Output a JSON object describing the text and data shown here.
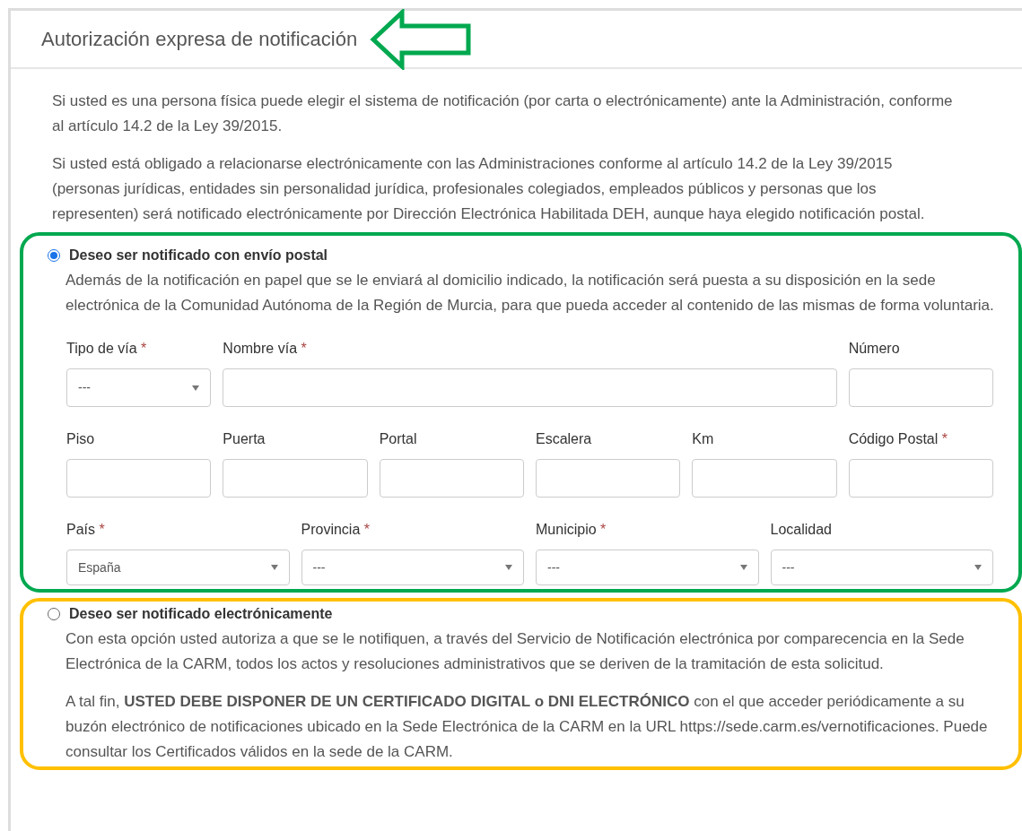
{
  "panel": {
    "title": "Autorización expresa de notificación"
  },
  "intro": [
    "Si usted es una persona física puede elegir el sistema de notificación (por carta o electrónicamente) ante la Administración, conforme al artículo 14.2 de la Ley 39/2015.",
    "Si usted está obligado a relacionarse electrónicamente con las Administraciones conforme al artículo 14.2 de la Ley 39/2015 (personas jurídicas, entidades sin personalidad jurídica, profesionales colegiados, empleados públicos y personas que los representen) será notificado electrónicamente por Dirección Electrónica Habilitada DEH, aunque haya elegido notificación postal."
  ],
  "options": [
    {
      "label": "Deseo ser notificado con envío postal",
      "selected": true,
      "paragraphs": [
        "Además de la notificación en papel que se le enviará al domicilio indicado, la notificación será puesta a su disposición en la sede electrónica de la Comunidad Autónoma de la Región de Murcia, para que pueda acceder al contenido de las mismas de forma voluntaria."
      ],
      "field_rows": [
        [
          {
            "kind": "select",
            "label": "Tipo de vía",
            "required_mark": "*",
            "value": "---"
          },
          {
            "kind": "wide_text",
            "label": "Nombre vía",
            "required_mark": "*"
          },
          {
            "kind": "text",
            "label": "Número"
          }
        ],
        [
          {
            "kind": "text",
            "label": "Piso"
          },
          {
            "kind": "text",
            "label": "Puerta"
          },
          {
            "kind": "text",
            "label": "Portal"
          },
          {
            "kind": "text",
            "label": "Escalera"
          },
          {
            "kind": "text",
            "label": "Km"
          },
          {
            "kind": "text",
            "label": "Código Postal",
            "required_mark": "*"
          }
        ],
        [
          {
            "kind": "select",
            "label": "País",
            "required_mark": "*",
            "value": "España"
          },
          {
            "kind": "select",
            "label": "Provincia",
            "required_mark": "*",
            "value": "---"
          },
          {
            "kind": "select",
            "label": "Municipio",
            "required_mark": "*",
            "value": "---"
          },
          {
            "kind": "select",
            "label": "Localidad",
            "value": "---"
          }
        ]
      ]
    },
    {
      "label": "Deseo ser notificado electrónicamente",
      "selected": false,
      "paragraphs": [
        "Con esta opción usted autoriza a que se le notifiquen, a través del Servicio de Notificación electrónica por comparecencia en la Sede Electrónica de la CARM, todos los actos y resoluciones administrativos que se deriven de la tramitación de esta solicitud.",
        "A tal fin, **USTED DEBE DISPONER DE UN CERTIFICADO DIGITAL o DNI ELECTRÓNICO** con el que acceder periódicamente a su buzón electrónico de notificaciones ubicado en la Sede Electrónica de la CARM en la URL https://sede.carm.es/vernotificaciones. Puede consultar los Certificados válidos en la sede de la CARM."
      ]
    }
  ]
}
